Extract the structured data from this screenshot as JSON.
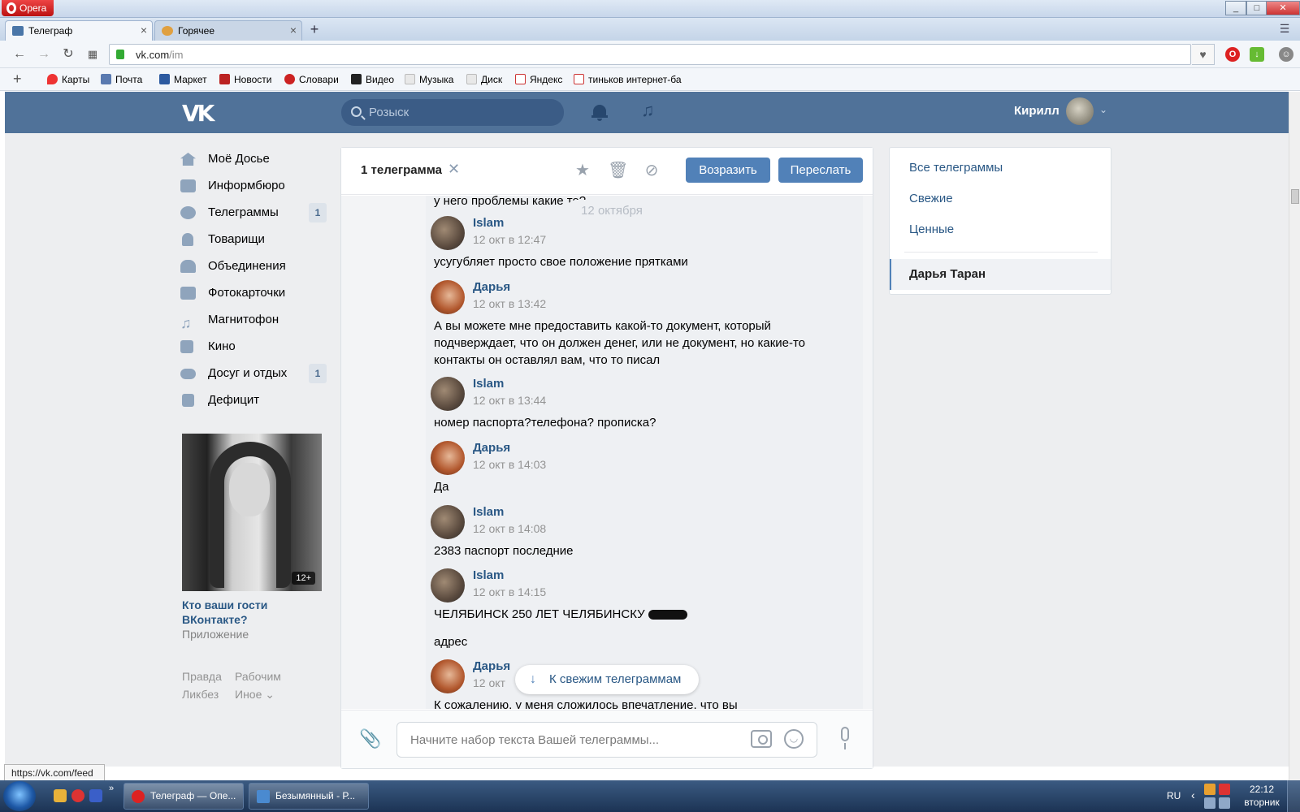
{
  "browser": {
    "app_name": "Opera",
    "tabs": [
      {
        "title": "Телеграф"
      },
      {
        "title": "Горячее"
      }
    ],
    "url_host": "vk.com",
    "url_path": "/im",
    "bookmarks": [
      "Карты",
      "Почта",
      "Маркет",
      "Новости",
      "Словари",
      "Видео",
      "Музыка",
      "Диск",
      "Яндекс",
      "тиньков интернет-ба"
    ],
    "status_url": "https://vk.com/feed"
  },
  "vk": {
    "search_placeholder": "Розыск",
    "user_name": "Кирилл"
  },
  "menu": {
    "items": [
      {
        "label": "Моё Досье",
        "badge": ""
      },
      {
        "label": "Информбюро",
        "badge": ""
      },
      {
        "label": "Телеграммы",
        "badge": "1"
      },
      {
        "label": "Товарищи",
        "badge": ""
      },
      {
        "label": "Объединения",
        "badge": ""
      },
      {
        "label": "Фотокарточки",
        "badge": ""
      },
      {
        "label": "Магнитофон",
        "badge": ""
      },
      {
        "label": "Кино",
        "badge": ""
      },
      {
        "label": "Досуг и отдых",
        "badge": "1"
      },
      {
        "label": "Дефицит",
        "badge": ""
      }
    ],
    "ad": {
      "age_badge": "12+",
      "title": "Кто ваши гости ВКонтакте?",
      "subtitle": "Приложение"
    },
    "footer": {
      "link1": "Правда",
      "link2": "Рабочим",
      "link3": "Ликбез",
      "link4": "Иное"
    }
  },
  "chat": {
    "header": {
      "selected_count": "1 телеграмма",
      "reply_button": "Возразить",
      "forward_button": "Переслать"
    },
    "top_fragment": "у него проблемы какие то?",
    "date_separator": "12 октября",
    "messages": [
      {
        "author": "Islam",
        "time": "12 окт в 12:47",
        "text": "усугубляет просто свое положение прятками"
      },
      {
        "author": "Дарья",
        "time": "12 окт в 13:42",
        "text": "А вы можете мне предоставить какой-то документ, который подчверждает, что он должен денег, или не документ, но какие-то контакты он оставлял вам, что то писал"
      },
      {
        "author": "Islam",
        "time": "12 окт в 13:44",
        "text": "номер паспорта?телефона? прописка?"
      },
      {
        "author": "Дарья",
        "time": "12 окт в 14:03",
        "text": "Да"
      },
      {
        "author": "Islam",
        "time": "12 окт в 14:08",
        "text": "2383 паспорт последние"
      },
      {
        "author": "Islam",
        "time": "12 окт в 14:15",
        "text": "ЧЕЛЯБИНСК 250 ЛЕТ ЧЕЛЯБИНСКУ",
        "text2": "адрес"
      },
      {
        "author": "Дарья",
        "time": "12 окт",
        "text": "К сожалению, у меня сложилось впечатление, что вы"
      }
    ],
    "scroll_to_fresh": "К свежим телеграммам",
    "composer_placeholder": "Начните набор текста Вашей телеграммы..."
  },
  "rightpanel": {
    "all": "Все телеграммы",
    "fresh": "Свежие",
    "valuable": "Ценные",
    "active_dialog": "Дарья Таран"
  },
  "taskbar": {
    "items": [
      "Телеграф — Опе...",
      "Безымянный - Р..."
    ],
    "lang": "RU",
    "time": "22:12",
    "day": "вторник"
  },
  "colors": {
    "vk_header": "#507299",
    "vk_link": "#2a5885",
    "vk_button": "#5181b8"
  }
}
